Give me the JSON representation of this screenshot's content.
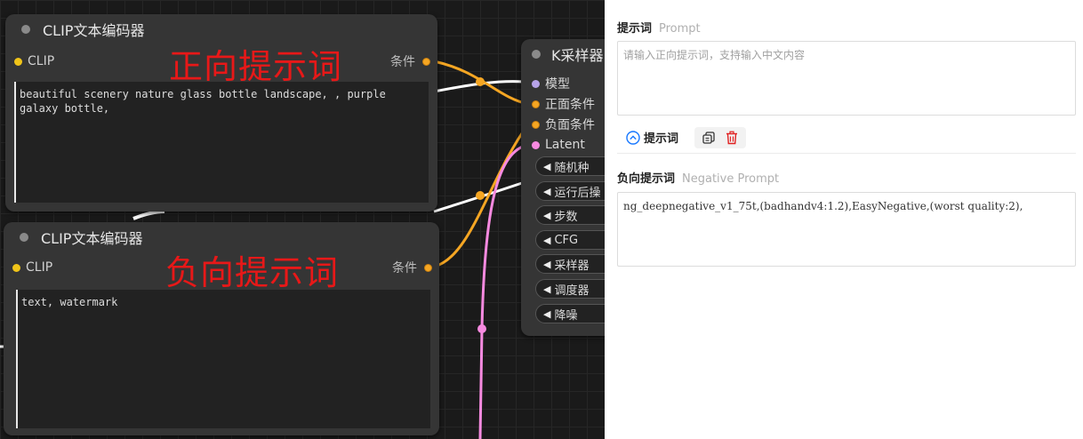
{
  "canvas": {
    "positive_node": {
      "title": "CLIP文本编码器",
      "input_label": "CLIP",
      "output_label": "条件",
      "text": "beautiful scenery nature glass bottle landscape, , purple galaxy bottle,",
      "annotation": "正向提示词"
    },
    "negative_node": {
      "title": "CLIP文本编码器",
      "input_label": "CLIP",
      "output_label": "条件",
      "text": "text, watermark",
      "annotation": "负向提示词"
    },
    "ksampler": {
      "title": "K采样器",
      "inputs": [
        {
          "label": "模型",
          "color": "#b7a3e8"
        },
        {
          "label": "正面条件",
          "color": "#f5a623"
        },
        {
          "label": "负面条件",
          "color": "#f5a623"
        },
        {
          "label": "Latent",
          "color": "#f78ae0"
        }
      ],
      "widgets": [
        "随机种",
        "运行后操",
        "步数",
        "CFG",
        "采样器",
        "调度器",
        "降噪"
      ]
    },
    "colors": {
      "conditioning_wire": "#f5a623",
      "latent_wire": "#f78ae0",
      "clip_wire": "#ffffff",
      "annotation": "#e81818"
    }
  },
  "panel": {
    "prompt": {
      "title": "提示词",
      "title_en": "Prompt",
      "placeholder": "请输入正向提示词，支持输入中文内容",
      "value": ""
    },
    "toolbar": {
      "toggle_label": "提示词",
      "icons": [
        "chevron-up-circle-icon",
        "copy-icon",
        "trash-icon"
      ]
    },
    "negative": {
      "title": "负向提示词",
      "title_en": "Negative Prompt",
      "value": "ng_deepnegative_v1_75t,(badhandv4:1.2),EasyNegative,(worst quality:2),"
    }
  }
}
